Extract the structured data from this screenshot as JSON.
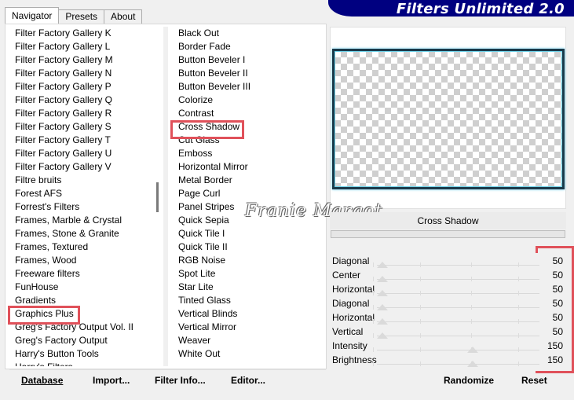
{
  "tabs": [
    {
      "label": "Navigator",
      "active": true
    },
    {
      "label": "Presets",
      "active": false
    },
    {
      "label": "About",
      "active": false
    }
  ],
  "banner": {
    "title": "Filters Unlimited 2.0",
    "color": "#000080"
  },
  "categories": [
    "Filter Factory Gallery K",
    "Filter Factory Gallery L",
    "Filter Factory Gallery M",
    "Filter Factory Gallery N",
    "Filter Factory Gallery P",
    "Filter Factory Gallery Q",
    "Filter Factory Gallery R",
    "Filter Factory Gallery S",
    "Filter Factory Gallery T",
    "Filter Factory Gallery U",
    "Filter Factory Gallery V",
    "Filtre bruits",
    "Forest AFS",
    "Forrest's Filters",
    "Frames, Marble & Crystal",
    "Frames, Stone & Granite",
    "Frames, Textured",
    "Frames, Wood",
    "Freeware filters",
    "FunHouse",
    "Gradients",
    "Graphics Plus",
    "Greg's Factory Output Vol. II",
    "Greg's Factory Output",
    "Harry's Button Tools",
    "Harry's Filters"
  ],
  "selected_category": "Graphics Plus",
  "filters": [
    "Black Out",
    "Border Fade",
    "Button Beveler I",
    "Button Beveler II",
    "Button Beveler III",
    "Colorize",
    "Contrast",
    "Cross Shadow",
    "Cut Glass",
    "Emboss",
    "Horizontal Mirror",
    "Metal Border",
    "Page Curl",
    "Panel Stripes",
    "Quick Sepia",
    "Quick Tile I",
    "Quick Tile II",
    "RGB Noise",
    "Spot Lite",
    "Star Lite",
    "Tinted Glass",
    "Vertical Blinds",
    "Vertical Mirror",
    "Weaver",
    "White Out"
  ],
  "selected_filter": "Cross Shadow",
  "watermark": "Franie Margot",
  "filter_name": "Cross Shadow",
  "params": [
    {
      "label": "Diagonal",
      "value": "50"
    },
    {
      "label": "Center",
      "value": "50"
    },
    {
      "label": "Horizontal",
      "value": "50"
    },
    {
      "label": "Diagonal",
      "value": "50"
    },
    {
      "label": "Horizontal",
      "value": "50"
    },
    {
      "label": "Vertical",
      "value": "50"
    },
    {
      "label": "Intensity",
      "value": "150"
    },
    {
      "label": "Brightness",
      "value": "150"
    }
  ],
  "buttons": {
    "database": "Database",
    "import": "Import...",
    "filter_info": "Filter Info...",
    "editor": "Editor...",
    "randomize": "Randomize",
    "reset": "Reset"
  },
  "highlight_color": "#e0515a"
}
